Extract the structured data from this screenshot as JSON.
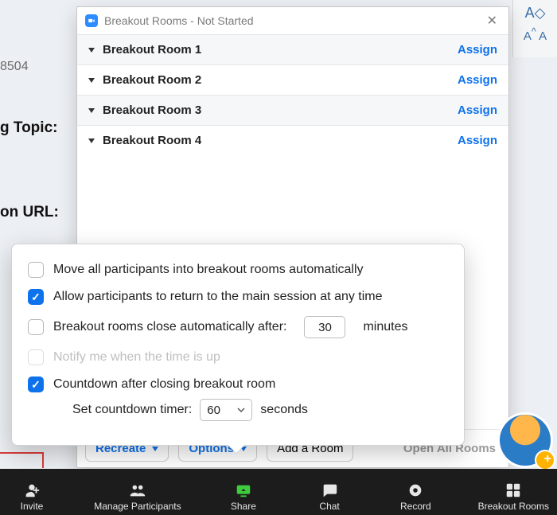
{
  "bg": {
    "num": "8504",
    "label1": "g Topic:",
    "label2": "on URL:"
  },
  "dialog": {
    "title": "Breakout Rooms - Not Started",
    "rooms": [
      {
        "name": "Breakout Room 1",
        "action": "Assign"
      },
      {
        "name": "Breakout Room 2",
        "action": "Assign"
      },
      {
        "name": "Breakout Room 3",
        "action": "Assign"
      },
      {
        "name": "Breakout Room 4",
        "action": "Assign"
      }
    ],
    "buttons": {
      "recreate": "Recreate",
      "options": "Options",
      "add_room": "Add a Room",
      "open_all": "Open All Rooms"
    }
  },
  "options": {
    "move_auto": "Move all participants into breakout rooms automatically",
    "allow_return": "Allow participants to return to the main session at any time",
    "close_after_prefix": "Breakout rooms close automatically after:",
    "close_after_minutes": "30",
    "close_after_suffix": "minutes",
    "notify": "Notify me when the time is up",
    "countdown": "Countdown after closing breakout room",
    "timer_label": "Set countdown timer:",
    "timer_value": "60",
    "timer_suffix": "seconds"
  },
  "toolbar": {
    "invite": "Invite",
    "manage": "Manage Participants",
    "share": "Share",
    "chat": "Chat",
    "record": "Record",
    "breakout": "Breakout Rooms"
  }
}
